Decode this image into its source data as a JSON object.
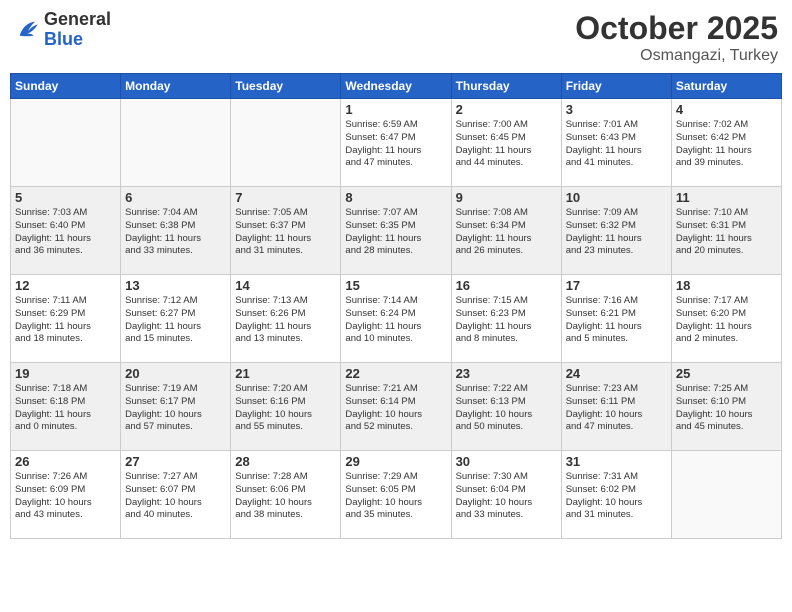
{
  "header": {
    "logo_general": "General",
    "logo_blue": "Blue",
    "title": "October 2025",
    "location": "Osmangazi, Turkey"
  },
  "days_of_week": [
    "Sunday",
    "Monday",
    "Tuesday",
    "Wednesday",
    "Thursday",
    "Friday",
    "Saturday"
  ],
  "weeks": [
    [
      {
        "day": "",
        "info": ""
      },
      {
        "day": "",
        "info": ""
      },
      {
        "day": "",
        "info": ""
      },
      {
        "day": "1",
        "info": "Sunrise: 6:59 AM\nSunset: 6:47 PM\nDaylight: 11 hours\nand 47 minutes."
      },
      {
        "day": "2",
        "info": "Sunrise: 7:00 AM\nSunset: 6:45 PM\nDaylight: 11 hours\nand 44 minutes."
      },
      {
        "day": "3",
        "info": "Sunrise: 7:01 AM\nSunset: 6:43 PM\nDaylight: 11 hours\nand 41 minutes."
      },
      {
        "day": "4",
        "info": "Sunrise: 7:02 AM\nSunset: 6:42 PM\nDaylight: 11 hours\nand 39 minutes."
      }
    ],
    [
      {
        "day": "5",
        "info": "Sunrise: 7:03 AM\nSunset: 6:40 PM\nDaylight: 11 hours\nand 36 minutes."
      },
      {
        "day": "6",
        "info": "Sunrise: 7:04 AM\nSunset: 6:38 PM\nDaylight: 11 hours\nand 33 minutes."
      },
      {
        "day": "7",
        "info": "Sunrise: 7:05 AM\nSunset: 6:37 PM\nDaylight: 11 hours\nand 31 minutes."
      },
      {
        "day": "8",
        "info": "Sunrise: 7:07 AM\nSunset: 6:35 PM\nDaylight: 11 hours\nand 28 minutes."
      },
      {
        "day": "9",
        "info": "Sunrise: 7:08 AM\nSunset: 6:34 PM\nDaylight: 11 hours\nand 26 minutes."
      },
      {
        "day": "10",
        "info": "Sunrise: 7:09 AM\nSunset: 6:32 PM\nDaylight: 11 hours\nand 23 minutes."
      },
      {
        "day": "11",
        "info": "Sunrise: 7:10 AM\nSunset: 6:31 PM\nDaylight: 11 hours\nand 20 minutes."
      }
    ],
    [
      {
        "day": "12",
        "info": "Sunrise: 7:11 AM\nSunset: 6:29 PM\nDaylight: 11 hours\nand 18 minutes."
      },
      {
        "day": "13",
        "info": "Sunrise: 7:12 AM\nSunset: 6:27 PM\nDaylight: 11 hours\nand 15 minutes."
      },
      {
        "day": "14",
        "info": "Sunrise: 7:13 AM\nSunset: 6:26 PM\nDaylight: 11 hours\nand 13 minutes."
      },
      {
        "day": "15",
        "info": "Sunrise: 7:14 AM\nSunset: 6:24 PM\nDaylight: 11 hours\nand 10 minutes."
      },
      {
        "day": "16",
        "info": "Sunrise: 7:15 AM\nSunset: 6:23 PM\nDaylight: 11 hours\nand 8 minutes."
      },
      {
        "day": "17",
        "info": "Sunrise: 7:16 AM\nSunset: 6:21 PM\nDaylight: 11 hours\nand 5 minutes."
      },
      {
        "day": "18",
        "info": "Sunrise: 7:17 AM\nSunset: 6:20 PM\nDaylight: 11 hours\nand 2 minutes."
      }
    ],
    [
      {
        "day": "19",
        "info": "Sunrise: 7:18 AM\nSunset: 6:18 PM\nDaylight: 11 hours\nand 0 minutes."
      },
      {
        "day": "20",
        "info": "Sunrise: 7:19 AM\nSunset: 6:17 PM\nDaylight: 10 hours\nand 57 minutes."
      },
      {
        "day": "21",
        "info": "Sunrise: 7:20 AM\nSunset: 6:16 PM\nDaylight: 10 hours\nand 55 minutes."
      },
      {
        "day": "22",
        "info": "Sunrise: 7:21 AM\nSunset: 6:14 PM\nDaylight: 10 hours\nand 52 minutes."
      },
      {
        "day": "23",
        "info": "Sunrise: 7:22 AM\nSunset: 6:13 PM\nDaylight: 10 hours\nand 50 minutes."
      },
      {
        "day": "24",
        "info": "Sunrise: 7:23 AM\nSunset: 6:11 PM\nDaylight: 10 hours\nand 47 minutes."
      },
      {
        "day": "25",
        "info": "Sunrise: 7:25 AM\nSunset: 6:10 PM\nDaylight: 10 hours\nand 45 minutes."
      }
    ],
    [
      {
        "day": "26",
        "info": "Sunrise: 7:26 AM\nSunset: 6:09 PM\nDaylight: 10 hours\nand 43 minutes."
      },
      {
        "day": "27",
        "info": "Sunrise: 7:27 AM\nSunset: 6:07 PM\nDaylight: 10 hours\nand 40 minutes."
      },
      {
        "day": "28",
        "info": "Sunrise: 7:28 AM\nSunset: 6:06 PM\nDaylight: 10 hours\nand 38 minutes."
      },
      {
        "day": "29",
        "info": "Sunrise: 7:29 AM\nSunset: 6:05 PM\nDaylight: 10 hours\nand 35 minutes."
      },
      {
        "day": "30",
        "info": "Sunrise: 7:30 AM\nSunset: 6:04 PM\nDaylight: 10 hours\nand 33 minutes."
      },
      {
        "day": "31",
        "info": "Sunrise: 7:31 AM\nSunset: 6:02 PM\nDaylight: 10 hours\nand 31 minutes."
      },
      {
        "day": "",
        "info": ""
      }
    ]
  ]
}
